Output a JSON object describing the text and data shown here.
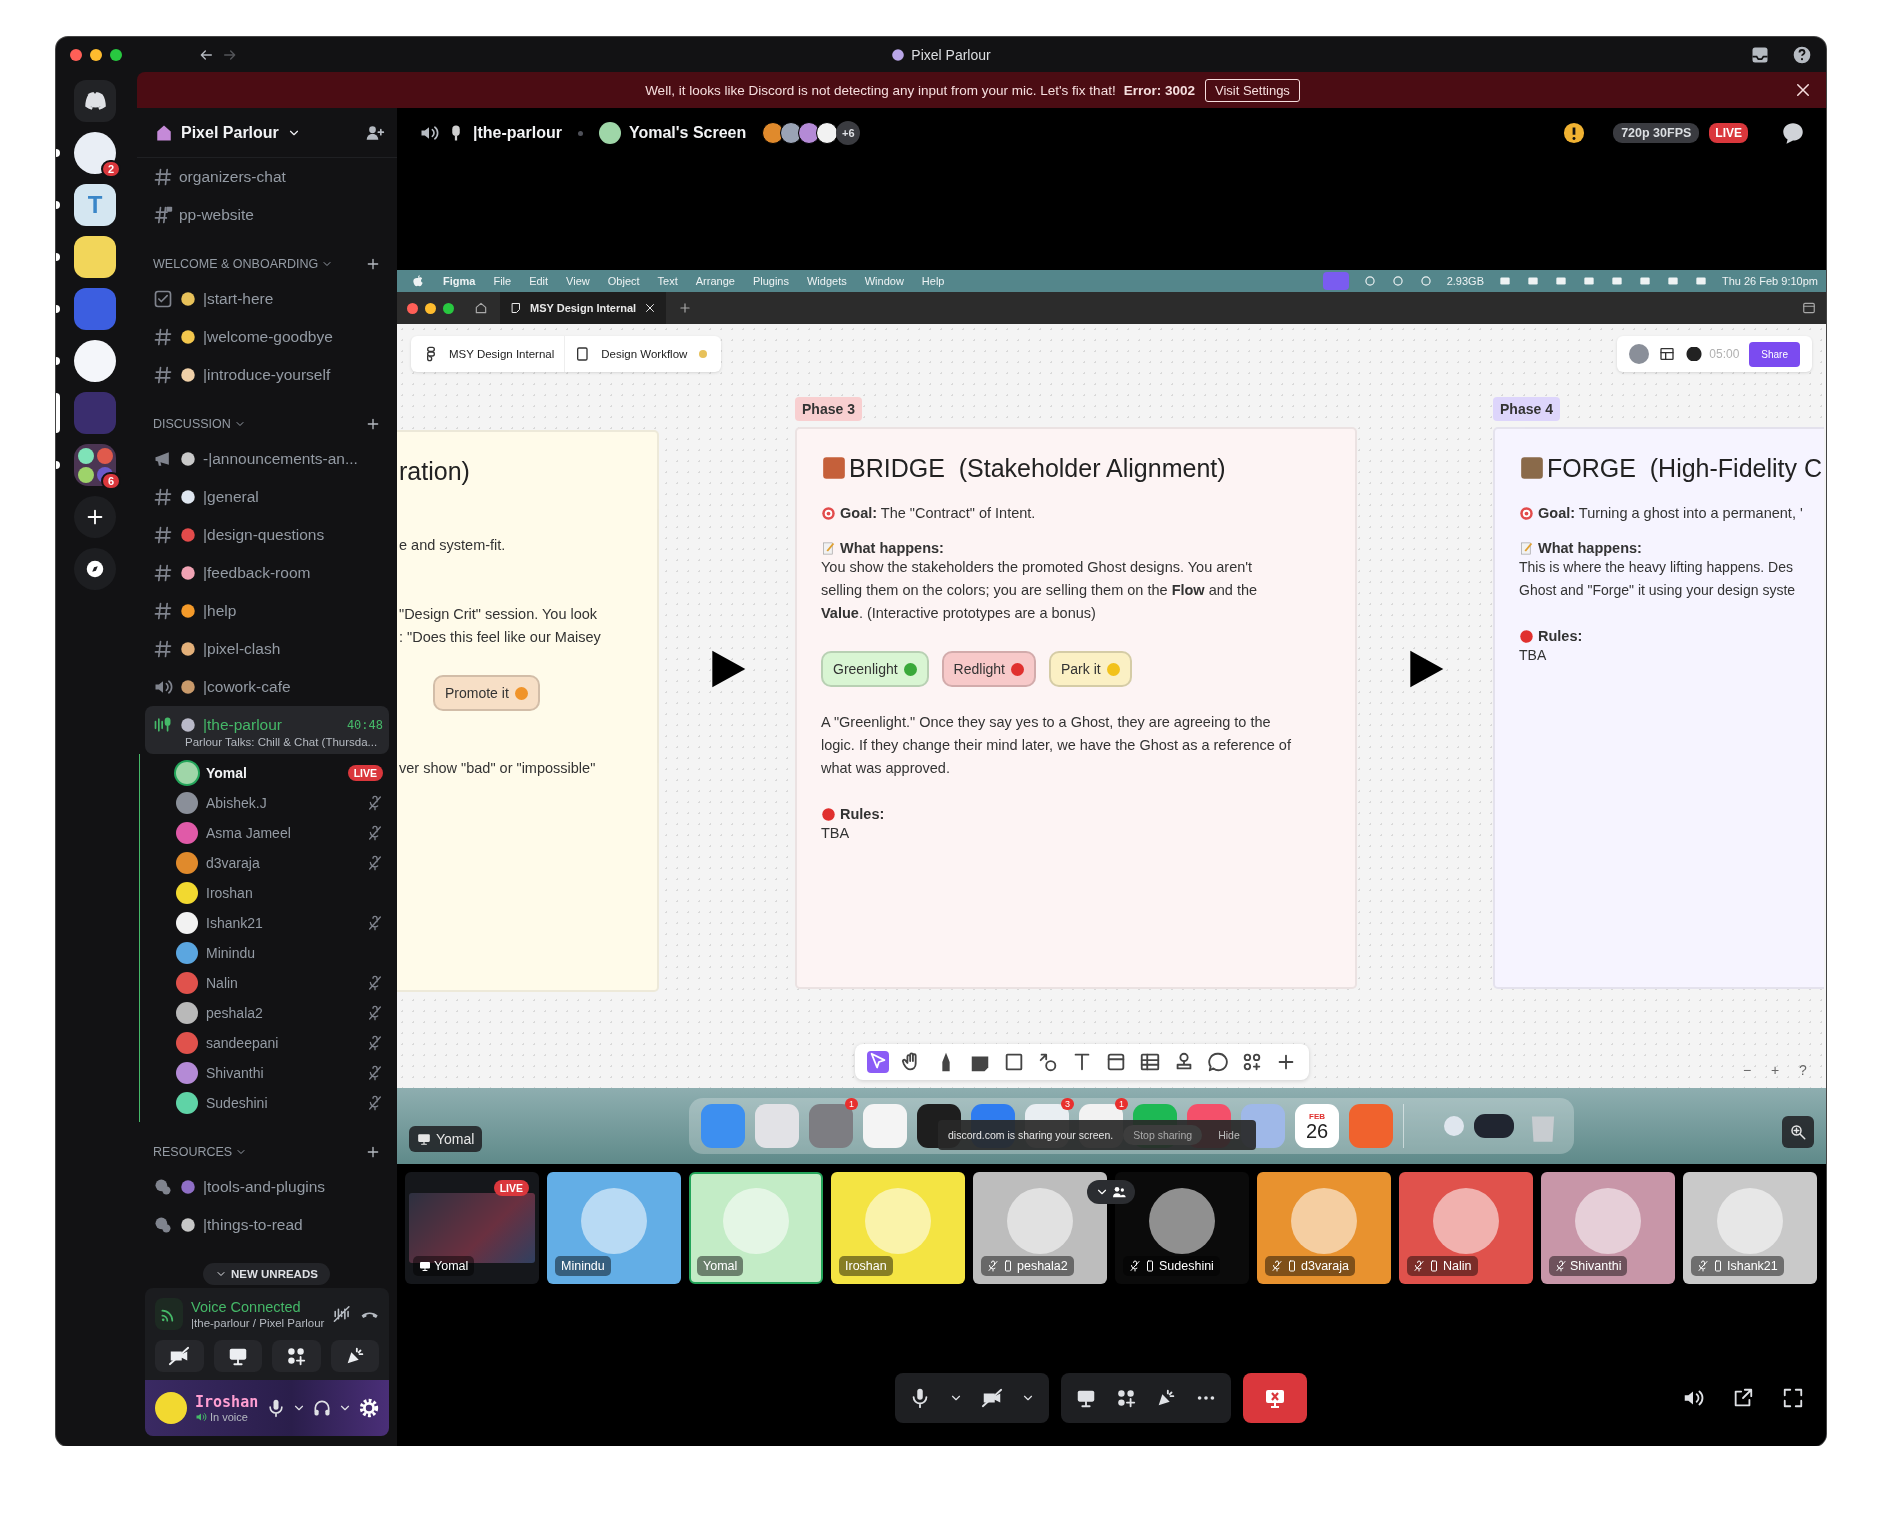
{
  "window": {
    "title": "Pixel Parlour"
  },
  "banner": {
    "message": "Well, it looks like Discord is not detecting any input from your mic. Let's fix that!",
    "error": "Error: 3002",
    "button": "Visit Settings"
  },
  "servers": [
    {
      "kind": "home",
      "selected": false,
      "unread": false
    },
    {
      "kind": "avatar",
      "color": "#e9eef5",
      "badge": "2",
      "selected": false,
      "unread": true
    },
    {
      "kind": "letter",
      "label": "T",
      "color": "#d4e6f1",
      "selected": false,
      "unread": true
    },
    {
      "kind": "plain",
      "color": "#f2d65a",
      "selected": false,
      "unread": true
    },
    {
      "kind": "plain",
      "color": "#3c5ee0",
      "selected": false,
      "unread": true
    },
    {
      "kind": "avatar",
      "color": "#f4f6fa",
      "selected": false,
      "unread": true
    },
    {
      "kind": "plain",
      "color": "#3a2d6e",
      "selected": true,
      "unread": false
    },
    {
      "kind": "folder",
      "color": "#4b3553",
      "badge": "6",
      "selected": false,
      "unread": true
    },
    {
      "kind": "add",
      "selected": false,
      "unread": false
    },
    {
      "kind": "discover",
      "selected": false,
      "unread": false
    }
  ],
  "sidebar": {
    "server_name": "Pixel Parlour",
    "categories": [
      {
        "channels": [
          {
            "kind": "text",
            "name": "organizers-chat"
          },
          {
            "kind": "locked",
            "name": "pp-website"
          }
        ]
      },
      {
        "name": "WELCOME & ONBOARDING",
        "channels": [
          {
            "kind": "rules",
            "emoji": true,
            "name": "|start-here"
          },
          {
            "kind": "text",
            "emoji": true,
            "name": "|welcome-goodbye"
          },
          {
            "kind": "text",
            "emoji": true,
            "name": "|introduce-yourself"
          }
        ]
      },
      {
        "name": "DISCUSSION",
        "channels": [
          {
            "kind": "announcement",
            "emoji": true,
            "name": "-|announcements-an..."
          },
          {
            "kind": "text",
            "emoji": true,
            "name": "|general"
          },
          {
            "kind": "text",
            "emoji": true,
            "name": "|design-questions"
          },
          {
            "kind": "text",
            "emoji": true,
            "name": "|feedback-room"
          },
          {
            "kind": "text",
            "emoji": true,
            "name": "|help"
          },
          {
            "kind": "text",
            "emoji": true,
            "name": "|pixel-clash"
          },
          {
            "kind": "voice",
            "emoji": true,
            "name": "|cowork-cafe"
          },
          {
            "kind": "stage",
            "emoji": true,
            "name": "|the-parlour",
            "selected": true,
            "timer": "40:48",
            "topic": "Parlour Talks: Chill & Chat (Thursda...",
            "members": [
              {
                "name": "Yomal",
                "color": "#9fd6a8",
                "speaking": true,
                "live": "LIVE",
                "muted": false
              },
              {
                "name": "Abishek.J",
                "color": "#8a8f99",
                "speaking": false,
                "muted": true
              },
              {
                "name": "Asma Jameel",
                "color": "#e05aa8",
                "speaking": false,
                "muted": true
              },
              {
                "name": "d3varaja",
                "color": "#e08a2c",
                "speaking": false,
                "muted": true
              },
              {
                "name": "Iroshan",
                "color": "#f2d930",
                "speaking": false,
                "muted": false
              },
              {
                "name": "Ishank21",
                "color": "#f2f2f2",
                "speaking": false,
                "muted": true
              },
              {
                "name": "Minindu",
                "color": "#5ba6e0",
                "speaking": false,
                "muted": false
              },
              {
                "name": "Nalin",
                "color": "#e0524c",
                "speaking": false,
                "muted": true
              },
              {
                "name": "peshala2",
                "color": "#b9b9b9",
                "speaking": false,
                "muted": true
              },
              {
                "name": "sandeepani",
                "color": "#e0524c",
                "speaking": false,
                "muted": true
              },
              {
                "name": "Shivanthi",
                "color": "#b48ad6",
                "speaking": false,
                "muted": true
              },
              {
                "name": "Sudeshini",
                "color": "#5fd3a6",
                "speaking": false,
                "muted": true
              }
            ]
          }
        ]
      },
      {
        "name": "RESOURCES",
        "channels": [
          {
            "kind": "forum",
            "emoji": true,
            "name": "|tools-and-plugins"
          },
          {
            "kind": "forum",
            "emoji": true,
            "name": "|things-to-read"
          }
        ]
      }
    ],
    "new_unreads": "NEW UNREADS",
    "voice": {
      "status": "Voice Connected",
      "channel": "|the-parlour / Pixel Parlour"
    },
    "user": {
      "name": "Iroshan",
      "status": "In voice"
    }
  },
  "stage_header": {
    "channel": "|the-parlour",
    "stream_title": "Yomal's Screen",
    "viewers": [
      {
        "color": "#e08a2c"
      },
      {
        "color": "#9aa3b5"
      },
      {
        "color": "#b48ad6"
      },
      {
        "color": "#f2f2f2"
      }
    ],
    "viewer_extra": "+6",
    "quality": "720p 30FPS",
    "live": "LIVE"
  },
  "shared_screen": {
    "menu_bar": {
      "items": [
        "Figma",
        "File",
        "Edit",
        "View",
        "Object",
        "Text",
        "Arrange",
        "Plugins",
        "Widgets",
        "Window",
        "Help"
      ],
      "memory": "2.93GB",
      "clock": "Thu 26 Feb 9:10pm"
    },
    "tab": {
      "title": "MSY Design Internal"
    },
    "toolbar": {
      "file": "MSY Design Internal",
      "page": "Design Workflow",
      "timer": "05:00",
      "share": "Share"
    },
    "cards": [
      {
        "color": "#fffbea",
        "title": "ration)",
        "blocks": [
          {
            "kind": "text",
            "lines": [
              "e and system-fit."
            ]
          },
          {
            "kind": "text",
            "lines": [
              "\"Design Crit\" session. You look",
              ": \"Does this feel like our Maisey"
            ]
          },
          {
            "kind": "buttons",
            "items": [
              {
                "label": "Promote it",
                "color": "#f7dfc6"
              }
            ]
          },
          {
            "kind": "text",
            "lines": [
              "ver show \"bad\" or \"impossible\""
            ]
          }
        ]
      },
      {
        "phase": {
          "label": "Phase 3",
          "color": "#f8cfd0"
        },
        "color": "#fdf4f4",
        "title": "BRIDGE  (Stakeholder Alignment)",
        "blocks": [
          {
            "kind": "goal",
            "text": "**Goal:** The \"Contract\" of Intent."
          },
          {
            "kind": "heading",
            "text": "What happens:"
          },
          {
            "kind": "paragraph",
            "lines": [
              "You show the stakeholders the promoted Ghost designs. You aren't",
              "selling them on the colors; you are selling them on the **Flow** and the",
              "**Value**. (Interactive prototypes are a bonus)"
            ]
          },
          {
            "kind": "buttons",
            "items": [
              {
                "label": "Greenlight",
                "color": "#d9f5d3"
              },
              {
                "label": "Redlight",
                "color": "#f7c9c9"
              },
              {
                "label": "Park it",
                "color": "#fbf0c4"
              }
            ]
          },
          {
            "kind": "text",
            "lines": [
              "A \"Greenlight.\" Once they say yes to a Ghost, they are agreeing to the",
              "logic. If they change their mind later, we have the Ghost as a reference of",
              "what was approved."
            ]
          },
          {
            "kind": "rules",
            "text": "Rules:"
          },
          {
            "kind": "paragraph",
            "lines": [
              "TBA"
            ]
          }
        ]
      },
      {
        "phase": {
          "label": "Phase 4",
          "color": "#ddd5fb"
        },
        "color": "#f6f4ff",
        "title": "FORGE  (High-Fidelity C",
        "blocks": [
          {
            "kind": "goal",
            "text": "**Goal:** Turning a ghost into a permanent, '"
          },
          {
            "kind": "heading",
            "text": "What happens:"
          },
          {
            "kind": "paragraph",
            "lines": [
              "This is where the heavy lifting happens. Des",
              "Ghost and \"Forge\" it using your design syste"
            ]
          },
          {
            "kind": "rules",
            "text": "Rules:"
          },
          {
            "kind": "paragraph",
            "lines": [
              "TBA"
            ]
          }
        ]
      }
    ],
    "canvas_tools": [
      {
        "selected": true
      },
      {
        "selected": false
      },
      {
        "selected": false
      },
      {
        "selected": false
      },
      {
        "selected": false
      },
      {
        "selected": false
      },
      {
        "selected": false
      },
      {
        "selected": false
      },
      {
        "selected": false
      },
      {
        "selected": false
      },
      {
        "selected": false
      },
      {
        "selected": false
      },
      {
        "selected": false
      }
    ],
    "zoom_controls": [
      "−",
      "+",
      "?"
    ],
    "dock": [
      {
        "color": "#3d8ff0"
      },
      {
        "color": "#e2e2e6"
      },
      {
        "color": "#7d7d82",
        "badge": "1"
      },
      {
        "color": "#f4f4f4"
      },
      {
        "color": "#1e1e1e"
      },
      {
        "color": "#2f7cf0"
      },
      {
        "color": "#e9eef2",
        "badge": "3"
      },
      {
        "color": "#f2f2f2",
        "badge": "1"
      },
      {
        "color": "#1db954"
      },
      {
        "color": "#f4506a"
      },
      {
        "color": "#9fb8e8"
      },
      {
        "color": "#ffffff",
        "month": "FEB",
        "day": "26"
      },
      {
        "color": "#f0622d"
      }
    ],
    "share_notice": {
      "text": "discord.com is sharing your screen.",
      "stop": "Stop sharing",
      "hide": "Hide"
    },
    "stream_label": "Yomal"
  },
  "tiles": [
    {
      "kind": "stream",
      "name": "Yomal",
      "live": "LIVE",
      "color": "#15171b"
    },
    {
      "kind": "user",
      "name": "Minindu",
      "color": "#63aee6",
      "selected": false,
      "muted": false,
      "mobile": false
    },
    {
      "kind": "user",
      "name": "Yomal",
      "color": "#c3ecc6",
      "selected": true,
      "muted": false,
      "mobile": false
    },
    {
      "kind": "user",
      "name": "Iroshan",
      "color": "#f4e443",
      "selected": false,
      "muted": false,
      "mobile": false
    },
    {
      "kind": "user",
      "name": "peshala2",
      "color": "#bdbdbd",
      "selected": false,
      "muted": true,
      "mobile": true
    },
    {
      "kind": "user",
      "name": "Sudeshini",
      "color": "#0b0b0b",
      "selected": false,
      "muted": true,
      "mobile": true
    },
    {
      "kind": "user",
      "name": "d3varaja",
      "color": "#e8922f",
      "selected": false,
      "muted": true,
      "mobile": true
    },
    {
      "kind": "user",
      "name": "Nalin",
      "color": "#e0524c",
      "selected": false,
      "muted": true,
      "mobile": true
    },
    {
      "kind": "user",
      "name": "Shivanthi",
      "color": "#c896a8",
      "selected": false,
      "muted": true,
      "mobile": false
    },
    {
      "kind": "user",
      "name": "Ishank21",
      "color": "#c9c9c9",
      "selected": false,
      "muted": true,
      "mobile": true
    }
  ]
}
